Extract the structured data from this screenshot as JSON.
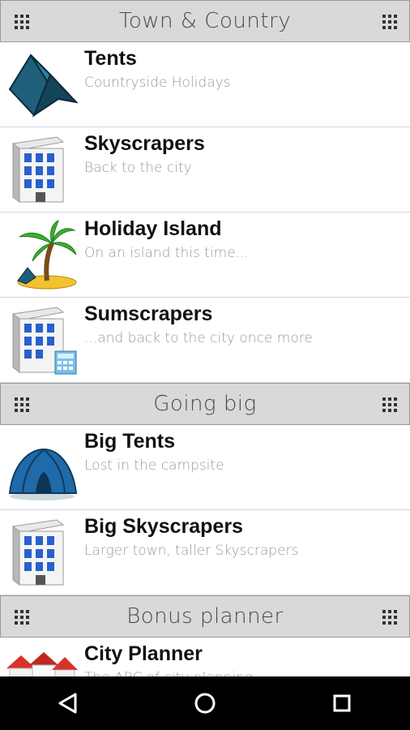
{
  "sections": [
    {
      "header": "Town & Country",
      "items": [
        {
          "title": "Tents",
          "subtitle": "Countryside Holidays",
          "icon": "tent-icon"
        },
        {
          "title": "Skyscrapers",
          "subtitle": "Back to the city",
          "icon": "skyscraper-icon"
        },
        {
          "title": "Holiday Island",
          "subtitle": "On an island this time...",
          "icon": "palm-island-icon"
        },
        {
          "title": "Sumscrapers",
          "subtitle": "...and back to the city once more",
          "icon": "skyscraper-calculator-icon"
        }
      ]
    },
    {
      "header": "Going big",
      "items": [
        {
          "title": "Big Tents",
          "subtitle": "Lost in the campsite",
          "icon": "dome-tent-icon"
        },
        {
          "title": "Big Skyscrapers",
          "subtitle": "Larger town, taller Skyscrapers",
          "icon": "skyscraper-icon"
        }
      ]
    },
    {
      "header": "Bonus planner",
      "items": [
        {
          "title": "City Planner",
          "subtitle": "The ABC of city planning",
          "icon": "city-houses-icon"
        }
      ]
    }
  ],
  "navbar": {
    "back": "back-icon",
    "home": "home-icon",
    "recents": "recents-icon"
  },
  "colors": {
    "header_bg": "#d9d9d9",
    "header_text": "#4a4a4a",
    "title": "#111111",
    "subtitle": "#9a9a9a",
    "navbar": "#000000"
  }
}
